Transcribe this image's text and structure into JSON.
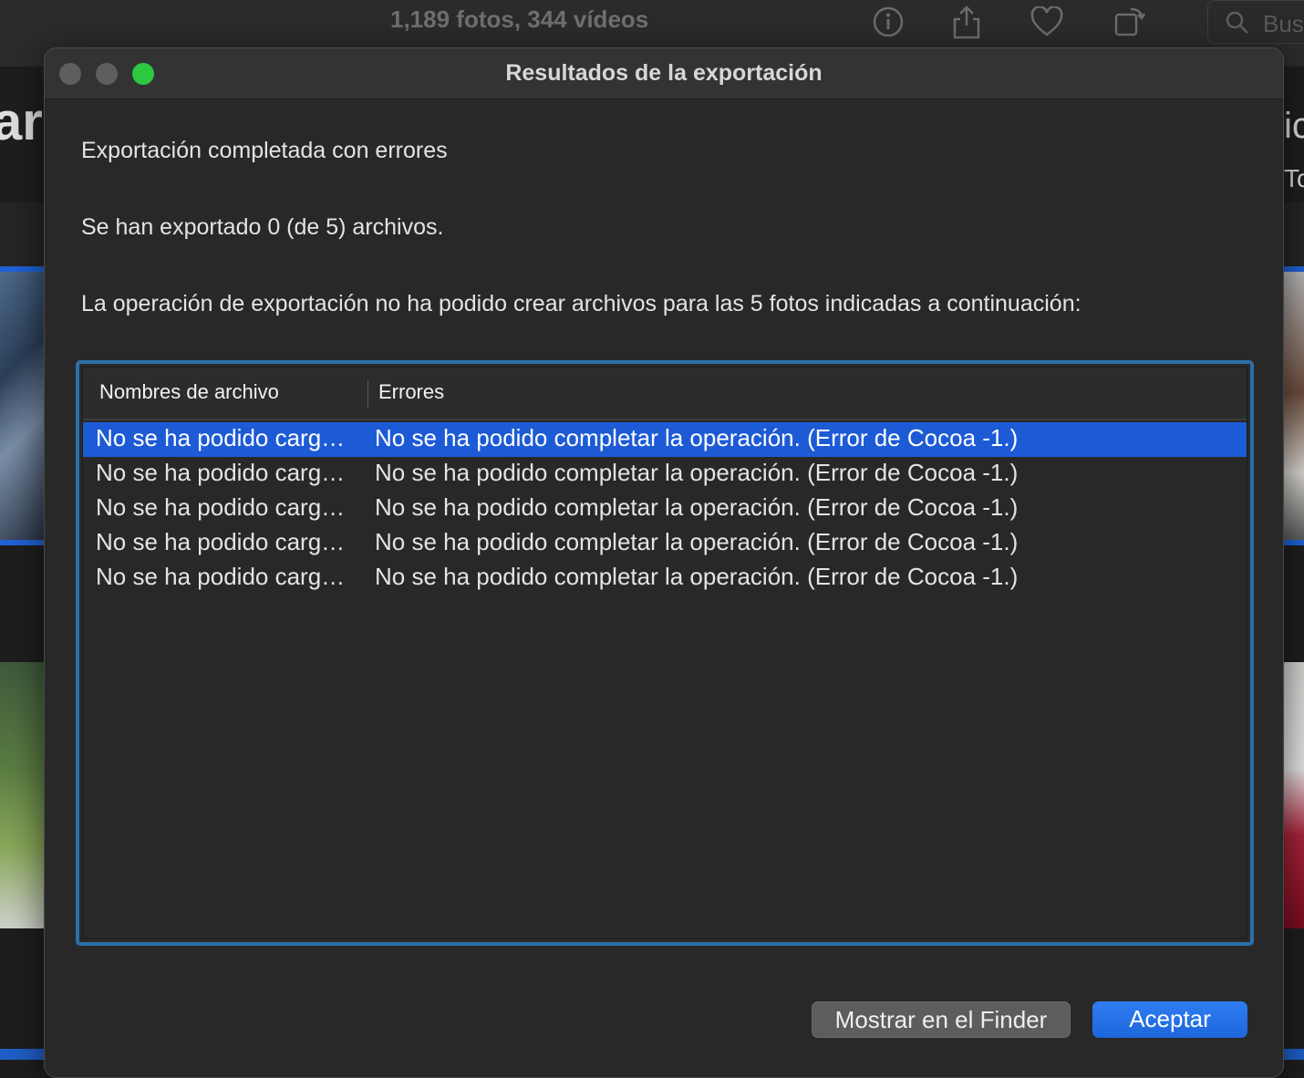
{
  "background_app": {
    "title": "1,189 fotos, 344 vídeos",
    "search_placeholder": "Bus",
    "left_partial_text": "arg",
    "right_partial_text_1": "ic",
    "right_partial_text_2": "To",
    "toolbar_icons": [
      "info-icon",
      "share-icon",
      "heart-icon",
      "rotate-icon",
      "search-icon"
    ]
  },
  "dialog": {
    "title": "Resultados de la exportación",
    "status": "Exportación completada con errores",
    "count_message": "Se han exportado 0 (de 5) archivos.",
    "detail_message": "La operación de exportación no ha podido crear archivos para las 5 fotos indicadas a continuación:",
    "table": {
      "columns": [
        "Nombres de archivo",
        "Errores"
      ],
      "selected_row": 0,
      "rows": [
        {
          "filename": "No se ha podido carg…",
          "error": "No se ha podido completar la operación. (Error de Cocoa -1.)"
        },
        {
          "filename": "No se ha podido carg…",
          "error": "No se ha podido completar la operación. (Error de Cocoa -1.)"
        },
        {
          "filename": "No se ha podido carg…",
          "error": "No se ha podido completar la operación. (Error de Cocoa -1.)"
        },
        {
          "filename": "No se ha podido carg…",
          "error": "No se ha podido completar la operación. (Error de Cocoa -1.)"
        },
        {
          "filename": "No se ha podido carg…",
          "error": "No se ha podido completar la operación. (Error de Cocoa -1.)"
        }
      ]
    },
    "buttons": {
      "show_in_finder": "Mostrar en el Finder",
      "accept": "Aceptar"
    }
  },
  "colors": {
    "accent": "#1d5bd6",
    "focus_ring": "#2b6fa8",
    "zoom_button": "#2bc840"
  }
}
